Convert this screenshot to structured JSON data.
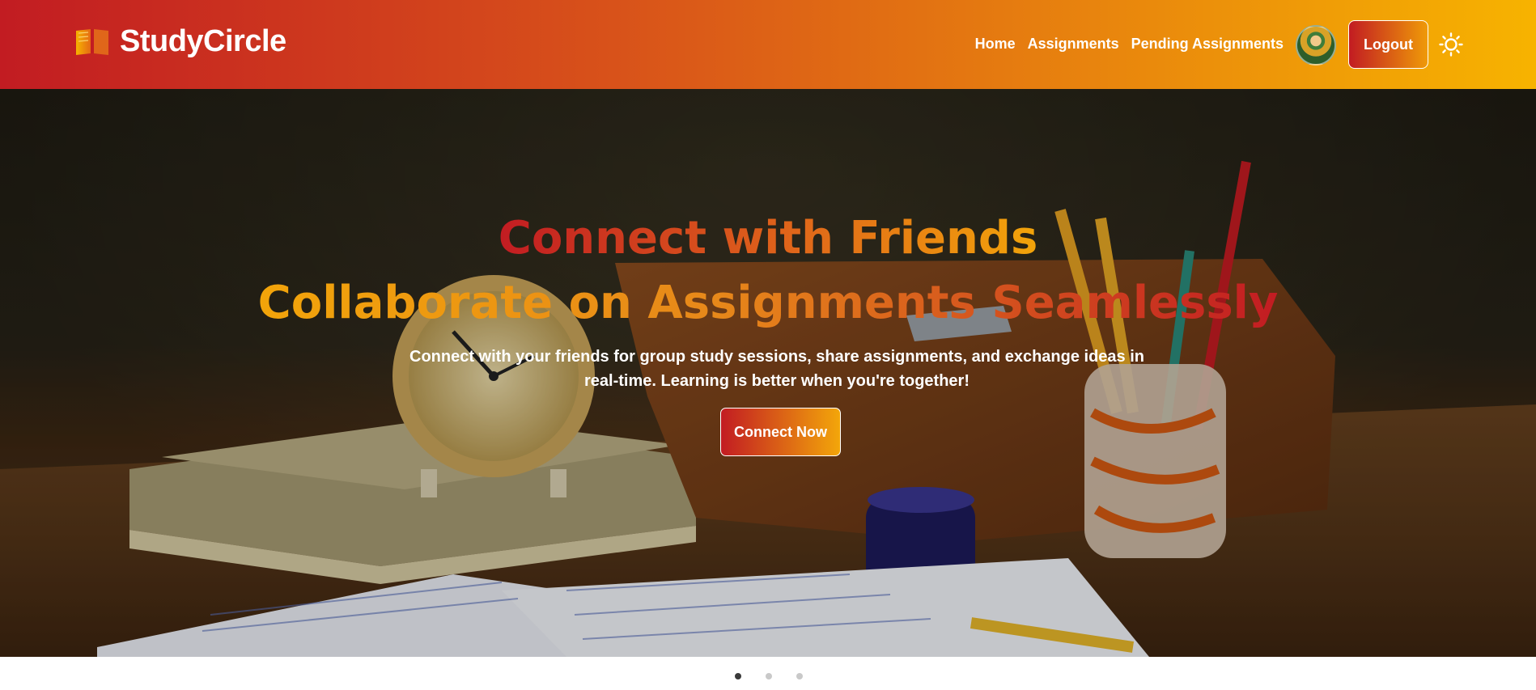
{
  "brand": {
    "name": "StudyCircle",
    "icon": "open-book-icon"
  },
  "nav": {
    "links": [
      {
        "label": "Home"
      },
      {
        "label": "Assignments"
      },
      {
        "label": "Pending Assignments"
      }
    ],
    "logout_label": "Logout",
    "theme_icon": "sun-icon"
  },
  "hero": {
    "title_line1": "Connect with Friends",
    "title_line2": "Collaborate on Assignments Seamlessly",
    "description": "Connect with your friends for group study sessions, share assignments, and exchange ideas in real-time. Learning is better when you're together!",
    "cta_label": "Connect Now"
  },
  "carousel": {
    "slide_count": 3,
    "active_index": 0
  },
  "colors": {
    "gradient_start": "#c21c22",
    "gradient_end": "#f7b300"
  }
}
